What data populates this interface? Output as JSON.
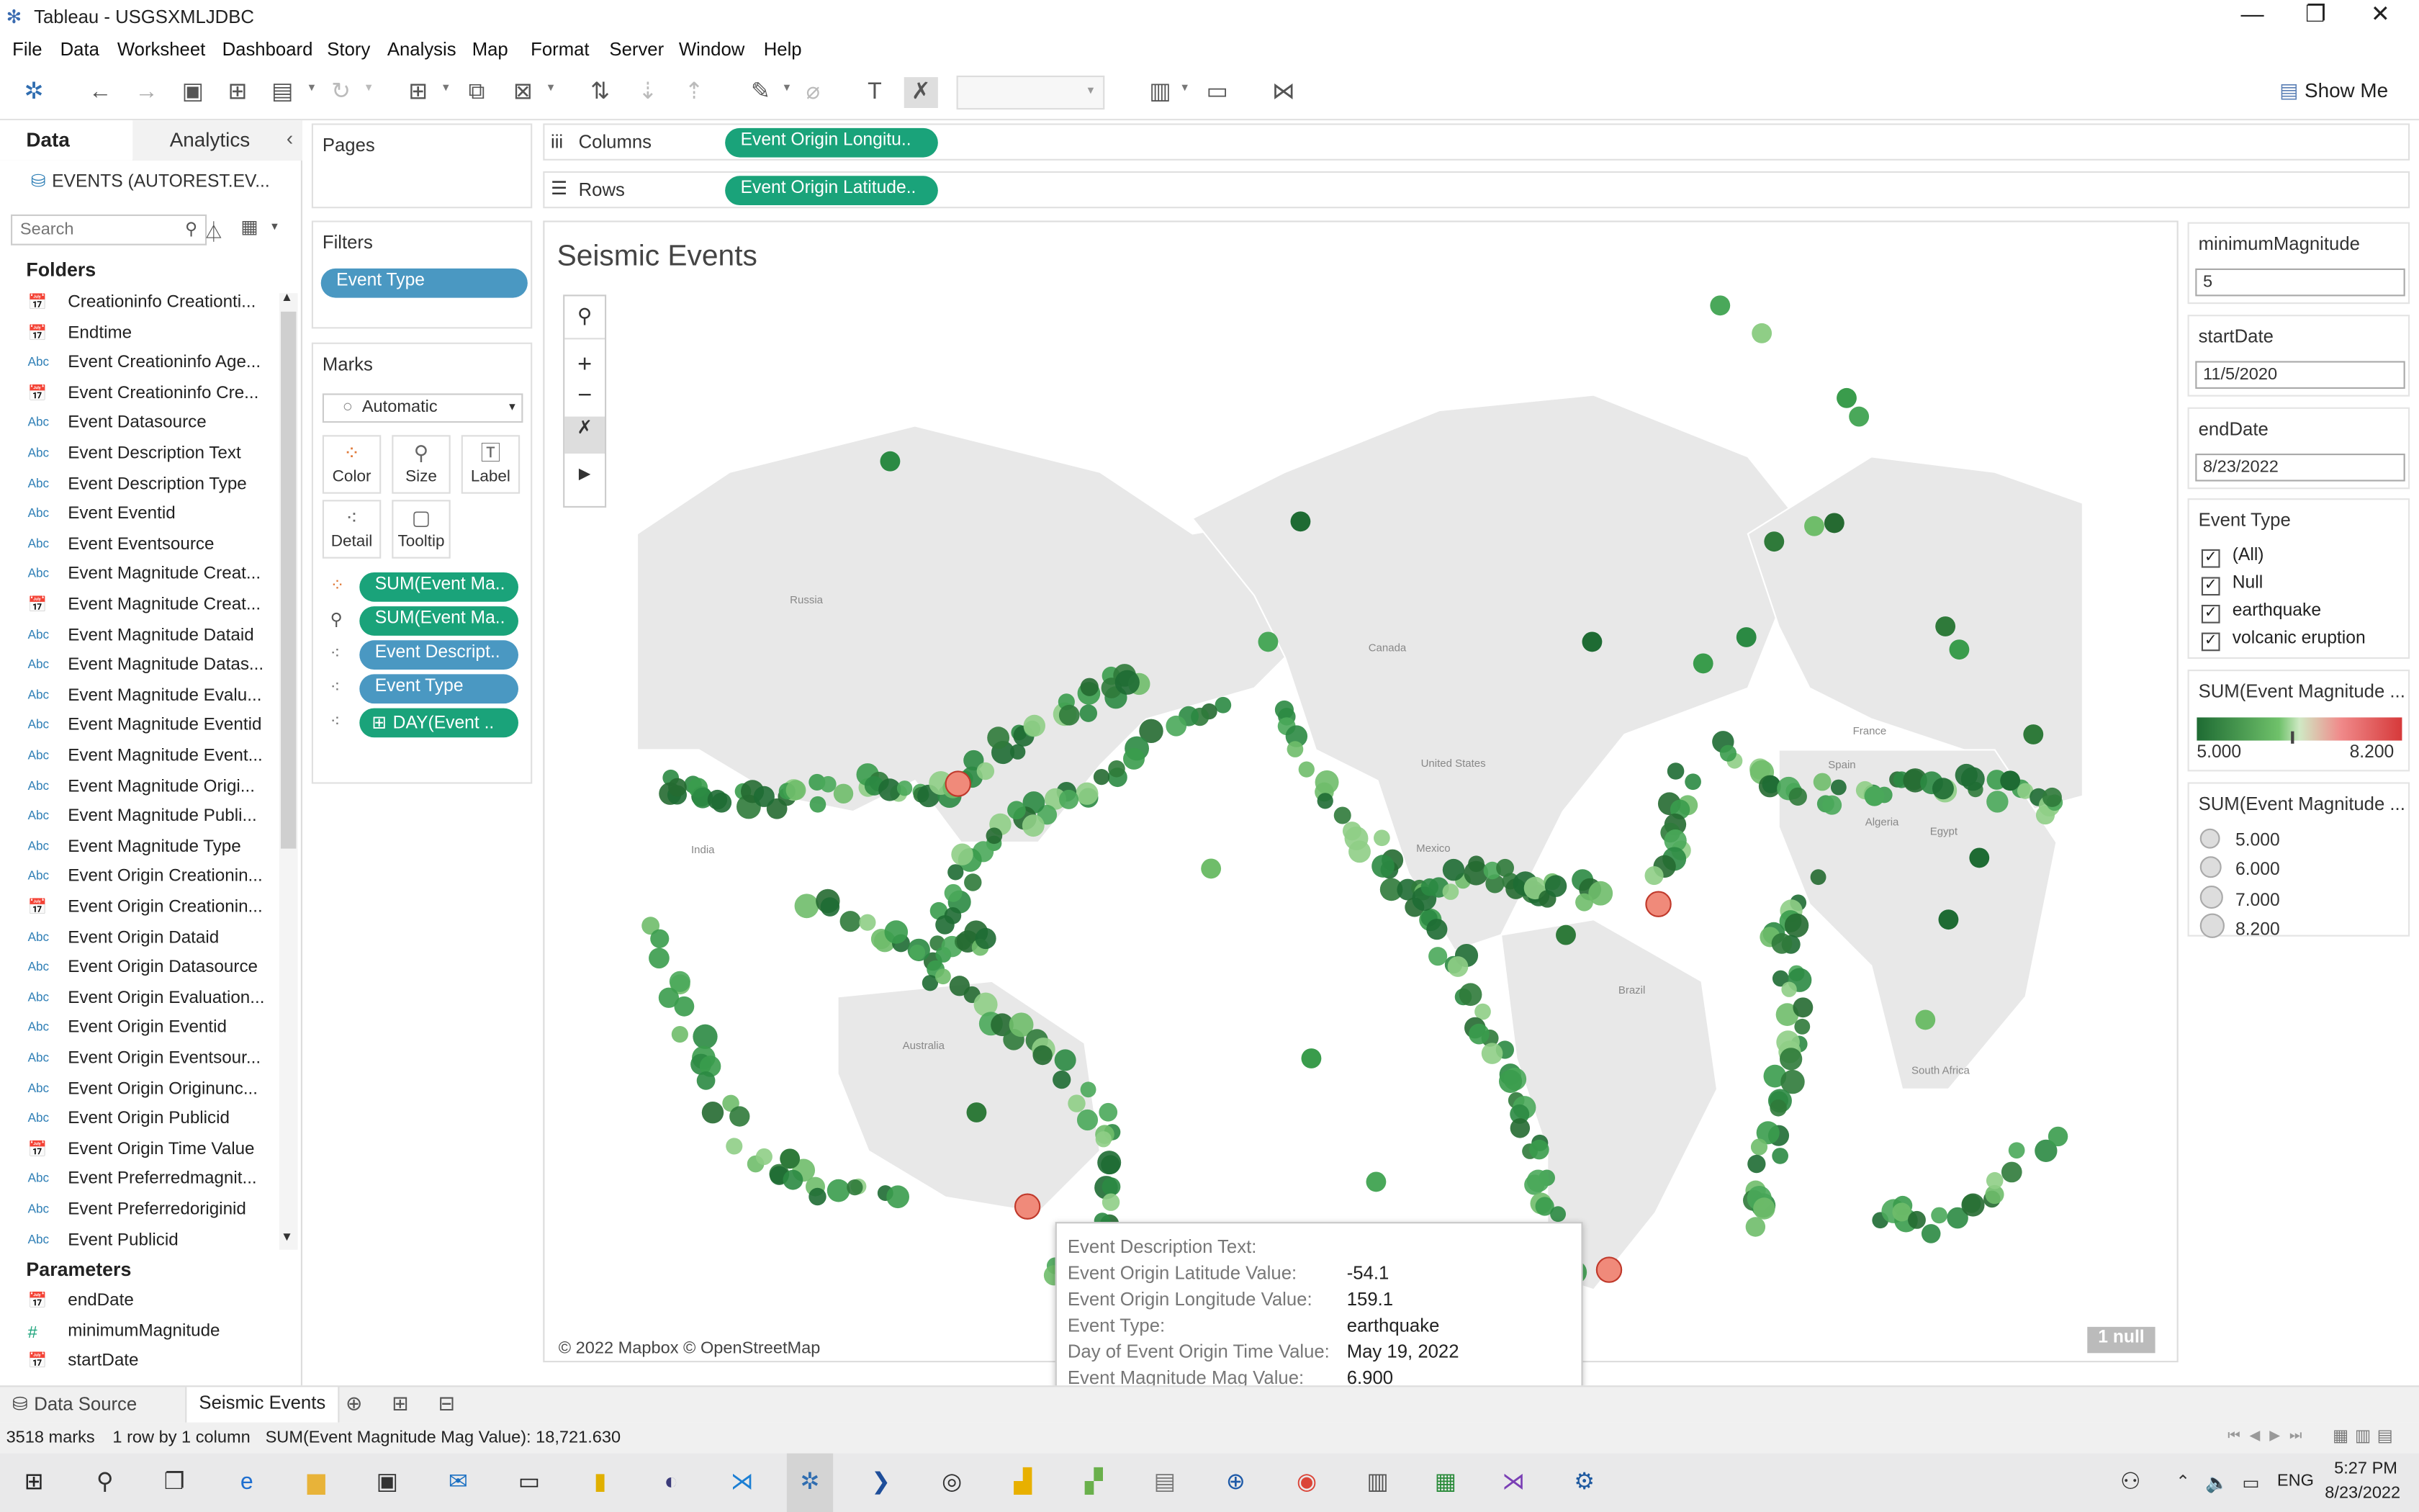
{
  "window": {
    "title": "Tableau - USGSXMLJDBC",
    "minimize": "—",
    "maximize": "❐",
    "close": "✕"
  },
  "menu": [
    "File",
    "Data",
    "Worksheet",
    "Dashboard",
    "Story",
    "Analysis",
    "Map",
    "Format",
    "Server",
    "Window",
    "Help"
  ],
  "toolbar": {
    "show_me": "Show Me"
  },
  "sidebar": {
    "tab_data": "Data",
    "tab_analytics": "Analytics",
    "datasource": "EVENTS (AUTOREST.EV...",
    "search_placeholder": "Search",
    "folders_header": "Folders",
    "fields": [
      {
        "type": "date",
        "label": "Creationinfo Creationti..."
      },
      {
        "type": "date",
        "label": "Endtime"
      },
      {
        "type": "Abc",
        "label": "Event Creationinfo Age..."
      },
      {
        "type": "date",
        "label": "Event Creationinfo Cre..."
      },
      {
        "type": "Abc",
        "label": "Event Datasource"
      },
      {
        "type": "Abc",
        "label": "Event Description Text"
      },
      {
        "type": "Abc",
        "label": "Event Description Type"
      },
      {
        "type": "Abc",
        "label": "Event Eventid"
      },
      {
        "type": "Abc",
        "label": "Event Eventsource"
      },
      {
        "type": "Abc",
        "label": "Event Magnitude Creat..."
      },
      {
        "type": "date",
        "label": "Event Magnitude Creat..."
      },
      {
        "type": "Abc",
        "label": "Event Magnitude Dataid"
      },
      {
        "type": "Abc",
        "label": "Event Magnitude Datas..."
      },
      {
        "type": "Abc",
        "label": "Event Magnitude Evalu..."
      },
      {
        "type": "Abc",
        "label": "Event Magnitude Eventid"
      },
      {
        "type": "Abc",
        "label": "Event Magnitude Event..."
      },
      {
        "type": "Abc",
        "label": "Event Magnitude Origi..."
      },
      {
        "type": "Abc",
        "label": "Event Magnitude Publi..."
      },
      {
        "type": "Abc",
        "label": "Event Magnitude Type"
      },
      {
        "type": "Abc",
        "label": "Event Origin Creationin..."
      },
      {
        "type": "date",
        "label": "Event Origin Creationin..."
      },
      {
        "type": "Abc",
        "label": "Event Origin Dataid"
      },
      {
        "type": "Abc",
        "label": "Event Origin Datasource"
      },
      {
        "type": "Abc",
        "label": "Event Origin Evaluation..."
      },
      {
        "type": "Abc",
        "label": "Event Origin Eventid"
      },
      {
        "type": "Abc",
        "label": "Event Origin Eventsour..."
      },
      {
        "type": "Abc",
        "label": "Event Origin Originunc..."
      },
      {
        "type": "Abc",
        "label": "Event Origin Publicid"
      },
      {
        "type": "date",
        "label": "Event Origin Time Value"
      },
      {
        "type": "Abc",
        "label": "Event Preferredmagnit..."
      },
      {
        "type": "Abc",
        "label": "Event Preferredoriginid"
      },
      {
        "type": "Abc",
        "label": "Event Publicid"
      }
    ],
    "parameters_header": "Parameters",
    "parameters": [
      {
        "type": "date",
        "label": "endDate"
      },
      {
        "type": "#",
        "label": "minimumMagnitude"
      },
      {
        "type": "date",
        "label": "startDate"
      }
    ]
  },
  "pages": {
    "title": "Pages"
  },
  "filters": {
    "title": "Filters",
    "items": [
      "Event Type"
    ]
  },
  "marks": {
    "title": "Marks",
    "type": "Automatic",
    "buttons": [
      "Color",
      "Size",
      "Label",
      "Detail",
      "Tooltip"
    ],
    "pills": [
      "SUM(Event Ma..",
      "SUM(Event Ma..",
      "Event Descript..",
      "Event Type",
      "DAY(Event .."
    ]
  },
  "shelves": {
    "columns_label": "Columns",
    "columns_pill": "Event Origin Longitu..",
    "rows_label": "Rows",
    "rows_pill": "Event Origin Latitude.."
  },
  "viz": {
    "title": "Seismic Events",
    "attribution": "© 2022 Mapbox © OpenStreetMap",
    "null_badge": "1 null",
    "map_labels": [
      "Russia",
      "Canada",
      "United States",
      "Mexico",
      "India",
      "Australia",
      "Brazil",
      "France",
      "Spain",
      "Algeria",
      "Egypt",
      "South Africa"
    ]
  },
  "params_panel": {
    "min_mag_label": "minimumMagnitude",
    "min_mag_value": "5",
    "start_label": "startDate",
    "start_value": "11/5/2020",
    "end_label": "endDate",
    "end_value": "8/23/2022",
    "event_type_label": "Event Type",
    "event_types": [
      "(All)",
      "Null",
      "earthquake",
      "volcanic eruption"
    ],
    "color_legend_title": "SUM(Event Magnitude ...",
    "color_min": "5.000",
    "color_max": "8.200",
    "size_legend_title": "SUM(Event Magnitude ...",
    "size_values": [
      "5.000",
      "6.000",
      "7.000",
      "8.200"
    ],
    "colors": {
      "low": "#1e6b33",
      "mid": "#cfe9c4",
      "high": "#d6393a"
    }
  },
  "tooltip": {
    "rows": [
      {
        "k": "Event Description Text:",
        "v": ""
      },
      {
        "k": "Event Origin Latitude Value:",
        "v": "-54.1"
      },
      {
        "k": "Event Origin Longitude Value:",
        "v": "159.1"
      },
      {
        "k": "Event Type:",
        "v": "earthquake"
      },
      {
        "k": "Day of Event Origin Time Value:",
        "v": "May 19, 2022"
      },
      {
        "k": "Event Magnitude Mag Value:",
        "v": "6.900"
      }
    ]
  },
  "sheets": {
    "data_source": "Data Source",
    "active": "Seismic Events"
  },
  "status": {
    "marks": "3518 marks",
    "dims": "1 row by 1 column",
    "sum": "SUM(Event Magnitude Mag Value): 18,721.630"
  },
  "taskbar": {
    "time": "5:27 PM",
    "date": "8/23/2022",
    "lang": "ENG"
  }
}
